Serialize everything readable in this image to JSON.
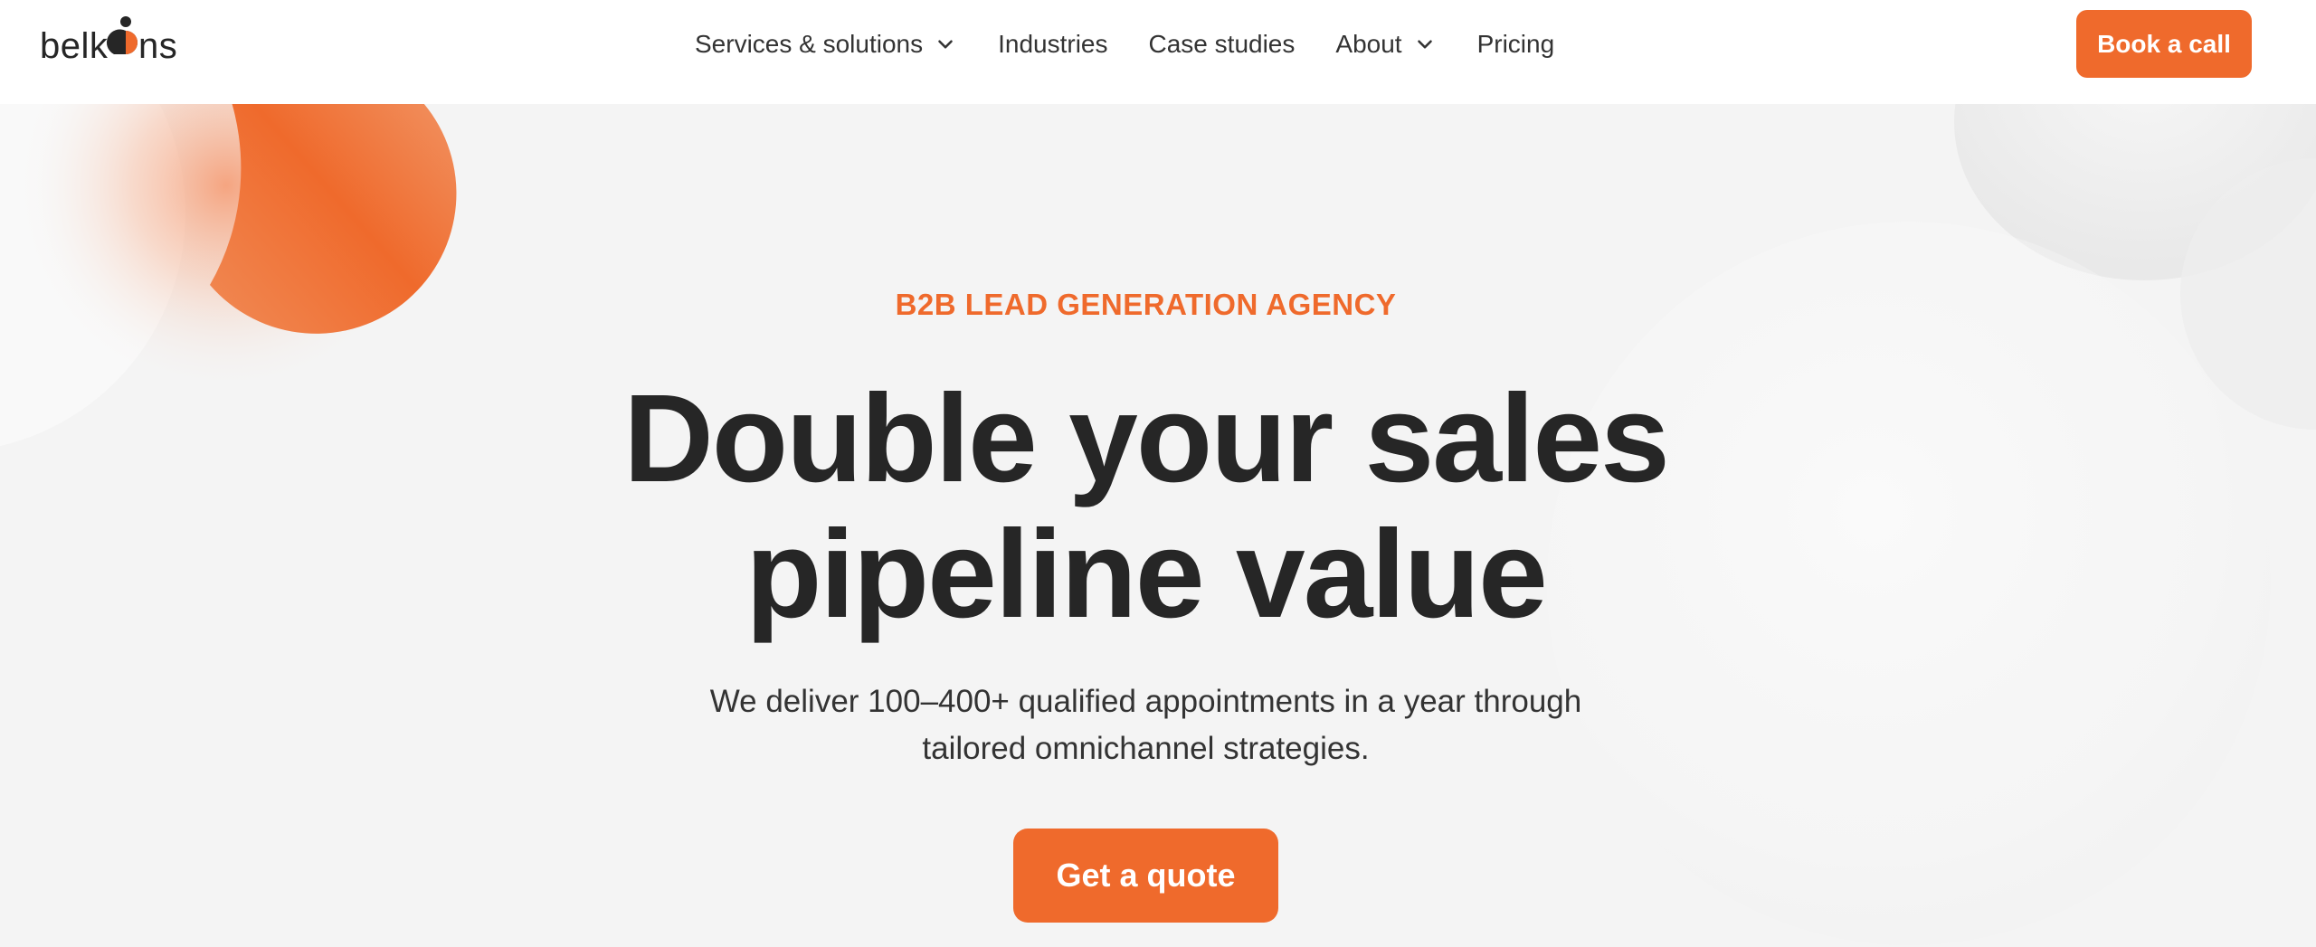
{
  "header": {
    "logo_text": "belkins",
    "logo_icon": "belkins-logo-mark",
    "nav": [
      {
        "label": "Services & solutions",
        "has_dropdown": true
      },
      {
        "label": "Industries",
        "has_dropdown": false
      },
      {
        "label": "Case studies",
        "has_dropdown": false
      },
      {
        "label": "About",
        "has_dropdown": true
      },
      {
        "label": "Pricing",
        "has_dropdown": false
      }
    ],
    "cta_label": "Book a call"
  },
  "hero": {
    "eyebrow": "B2B LEAD GENERATION AGENCY",
    "headline_line1": "Double your sales",
    "headline_line2": "pipeline value",
    "subtext_line1": "We deliver 100–400+ qualified appointments in a year through",
    "subtext_line2": "tailored omnichannel strategies.",
    "cta_label": "Get a quote"
  },
  "colors": {
    "accent": "#ef6a2c",
    "background": "#f4f4f4",
    "text": "#262626",
    "header_bg": "#ffffff"
  }
}
